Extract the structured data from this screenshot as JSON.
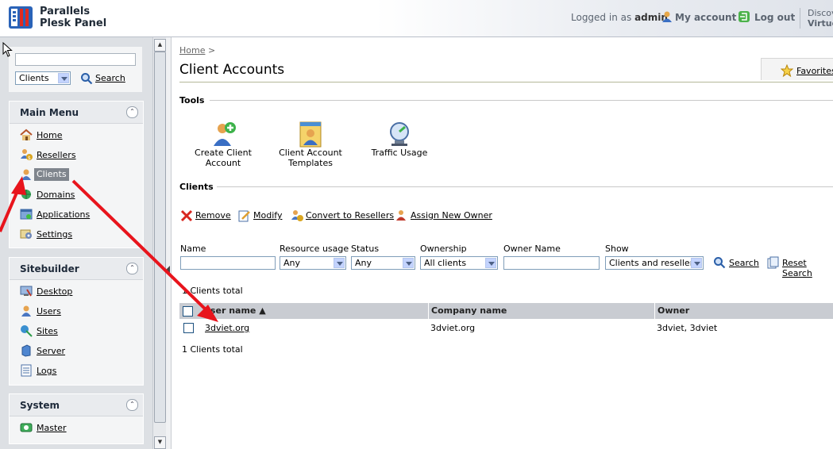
{
  "header": {
    "brand_line1": "Parallels",
    "brand_line2": "Plesk Panel",
    "logged_in_prefix": "Logged in as",
    "user": "admin",
    "my_account": "My account",
    "log_out": "Log out",
    "discover_line1": "Discov",
    "discover_line2": "Virtuo"
  },
  "search": {
    "input_value": "",
    "scope": "Clients",
    "button": "Search"
  },
  "main_menu": {
    "title": "Main Menu",
    "items": [
      {
        "label": "Home",
        "icon": "home-icon"
      },
      {
        "label": "Resellers",
        "icon": "resellers-icon"
      },
      {
        "label": "Clients",
        "icon": "clients-icon"
      },
      {
        "label": "Domains",
        "icon": "domains-icon"
      },
      {
        "label": "Applications",
        "icon": "applications-icon"
      },
      {
        "label": "Settings",
        "icon": "settings-icon"
      }
    ]
  },
  "sitebuilder": {
    "title": "Sitebuilder",
    "items": [
      {
        "label": "Desktop",
        "icon": "desktop-icon"
      },
      {
        "label": "Users",
        "icon": "users-icon"
      },
      {
        "label": "Sites",
        "icon": "sites-icon"
      },
      {
        "label": "Server",
        "icon": "server-icon"
      },
      {
        "label": "Logs",
        "icon": "logs-icon"
      }
    ]
  },
  "system": {
    "title": "System",
    "items": [
      {
        "label": "Master",
        "icon": "master-icon"
      }
    ]
  },
  "content": {
    "breadcrumb_home": "Home",
    "breadcrumb_sep": ">",
    "page_title": "Client Accounts",
    "favorites": "Favorites",
    "tools_title": "Tools",
    "tools": [
      {
        "label_line1": "Create Client Account",
        "label_line2": ""
      },
      {
        "label_line1": "Client Account",
        "label_line2": "Templates"
      },
      {
        "label_line1": "Traffic Usage",
        "label_line2": ""
      }
    ],
    "clients_title": "Clients",
    "actions": [
      "Remove",
      "Modify",
      "Convert to Resellers",
      "Assign New Owner"
    ],
    "filters": {
      "name_label": "Name",
      "name_value": "",
      "resource_label": "Resource usage",
      "resource_value": "Any",
      "status_label": "Status",
      "status_value": "Any",
      "ownership_label": "Ownership",
      "ownership_value": "All clients",
      "owner_name_label": "Owner Name",
      "owner_name_value": "",
      "show_label": "Show",
      "show_value": "Clients and resellers",
      "search": "Search",
      "reset": "Reset Search"
    },
    "total_top": "1 Clients total",
    "total_bottom": "1 Clients total",
    "table": {
      "columns": [
        "User name ▲",
        "Company name",
        "Owner"
      ],
      "rows": [
        {
          "user": "3dviet.org",
          "company": "3dviet.org",
          "owner": "3dviet, 3dviet"
        }
      ]
    }
  },
  "colors": {
    "arrow": "#e8141c",
    "panel_bg": "#dde0e4",
    "selected_bg": "#7f858d",
    "table_header": "#c9ccd2"
  }
}
